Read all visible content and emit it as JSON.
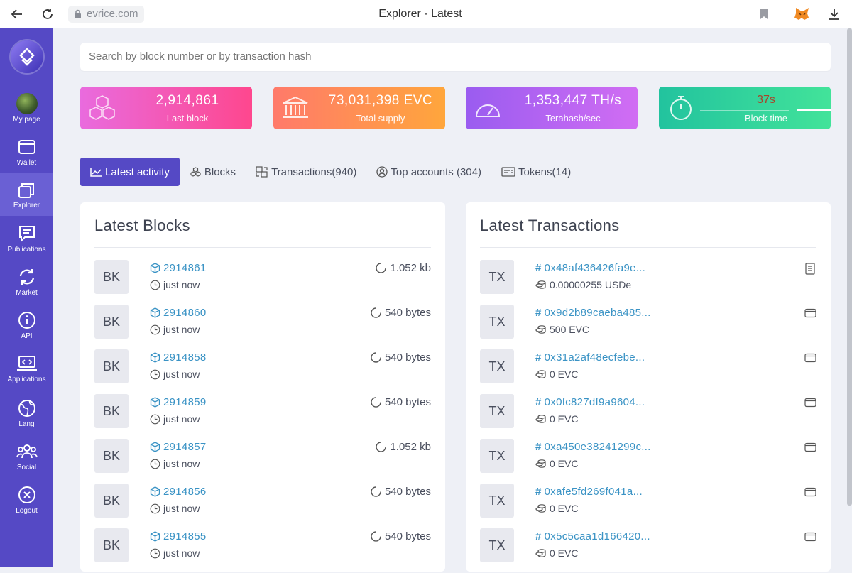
{
  "browser": {
    "url": "evrice.com",
    "title": "Explorer - Latest",
    "icons": [
      "back-arrow-icon",
      "reload-icon",
      "lock-icon",
      "bookmark-icon",
      "metamask-fox-icon",
      "download-icon"
    ]
  },
  "sidebar": {
    "items": [
      {
        "label": "My page",
        "icon": "avatar"
      },
      {
        "label": "Wallet",
        "icon": "wallet-icon"
      },
      {
        "label": "Explorer",
        "icon": "layers-icon",
        "active": true
      },
      {
        "label": "Publications",
        "icon": "chat-icon"
      },
      {
        "label": "Market",
        "icon": "exchange-icon"
      },
      {
        "label": "API",
        "icon": "info-icon"
      },
      {
        "label": "Applications",
        "icon": "laptop-code-icon"
      },
      {
        "label": "Lang",
        "icon": "globe-icon"
      },
      {
        "label": "Social",
        "icon": "users-icon"
      },
      {
        "label": "Logout",
        "icon": "close-circle-icon"
      }
    ]
  },
  "search": {
    "placeholder": "Search by block number or by transaction hash"
  },
  "stats": [
    {
      "value": "2,914,861",
      "label": "Last block",
      "icon": "cubes-icon"
    },
    {
      "value": "73,031,398 EVC",
      "label": "Total supply",
      "icon": "bank-icon"
    },
    {
      "value": "1,353,447 TH/s",
      "label": "Terahash/sec",
      "icon": "gauge-icon"
    },
    {
      "value": "37s",
      "label": "Block time",
      "icon": "stopwatch-icon"
    }
  ],
  "tabs": [
    {
      "label": "Latest activity",
      "icon": "chart-line-icon",
      "active": true
    },
    {
      "label": "Blocks",
      "icon": "cubes-icon"
    },
    {
      "label": "Transactions(940)",
      "icon": "exchange-icon"
    },
    {
      "label": "Top accounts (304)",
      "icon": "user-circle-icon"
    },
    {
      "label": "Tokens(14)",
      "icon": "card-icon"
    }
  ],
  "latest_blocks": {
    "title": "Latest Blocks",
    "badge": "BK",
    "rows": [
      {
        "number": "2914861",
        "time": "just now",
        "size": "1.052 kb"
      },
      {
        "number": "2914860",
        "time": "just now",
        "size": "540 bytes"
      },
      {
        "number": "2914858",
        "time": "just now",
        "size": "540 bytes"
      },
      {
        "number": "2914859",
        "time": "just now",
        "size": "540 bytes"
      },
      {
        "number": "2914857",
        "time": "just now",
        "size": "1.052 kb"
      },
      {
        "number": "2914856",
        "time": "just now",
        "size": "540 bytes"
      },
      {
        "number": "2914855",
        "time": "just now",
        "size": "540 bytes"
      }
    ]
  },
  "latest_transactions": {
    "title": "Latest Transactions",
    "badge": "TX",
    "rows": [
      {
        "hash": "0x48af436426fa9e...",
        "amount": "0.00000255 USDe",
        "type_icon": "document-icon"
      },
      {
        "hash": "0x9d2b89caeba485...",
        "amount": "500 EVC",
        "type_icon": "wallet-icon"
      },
      {
        "hash": "0x31a2af48ecfebe...",
        "amount": "0 EVC",
        "type_icon": "wallet-icon"
      },
      {
        "hash": "0x0fc827df9a9604...",
        "amount": "0 EVC",
        "type_icon": "wallet-icon"
      },
      {
        "hash": "0xa450e38241299c...",
        "amount": "0 EVC",
        "type_icon": "wallet-icon"
      },
      {
        "hash": "0xafe5fd269f041a...",
        "amount": "0 EVC",
        "type_icon": "wallet-icon"
      },
      {
        "hash": "0x5c5caa1d166420...",
        "amount": "0 EVC",
        "type_icon": "wallet-icon"
      }
    ]
  },
  "colors": {
    "sidebar": "#5549c5",
    "accent": "#5549c5",
    "link": "#3a93c5"
  }
}
